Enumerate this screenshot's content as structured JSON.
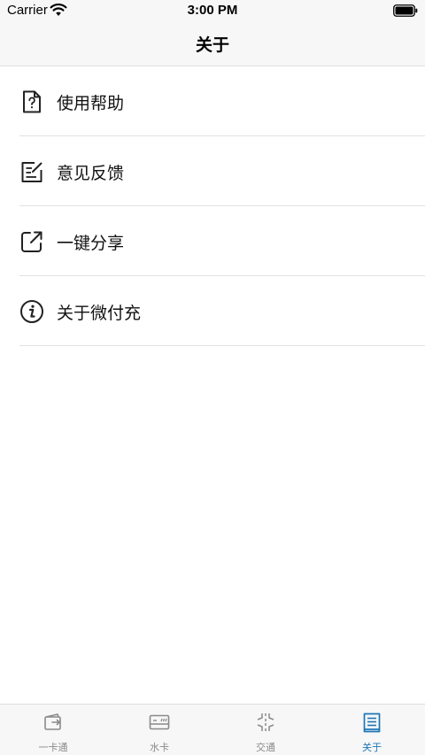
{
  "status_bar": {
    "carrier": "Carrier",
    "time": "3:00 PM",
    "icons": [
      "wifi-icon",
      "battery-icon"
    ]
  },
  "nav": {
    "title": "关于"
  },
  "menu": {
    "items": [
      {
        "label": "使用帮助",
        "icon": "help-document-icon"
      },
      {
        "label": "意见反馈",
        "icon": "feedback-edit-icon"
      },
      {
        "label": "一键分享",
        "icon": "share-external-icon"
      },
      {
        "label": "关于微付充",
        "icon": "info-circle-icon"
      }
    ]
  },
  "tab_bar": {
    "active_color": "#1c76b5",
    "inactive_color": "#8a8a8a",
    "tabs": [
      {
        "label": "一卡通",
        "icon": "card-transfer-icon",
        "active": false
      },
      {
        "label": "水卡",
        "icon": "water-card-icon",
        "active": false
      },
      {
        "label": "交通",
        "icon": "road-icon",
        "active": false
      },
      {
        "label": "关于",
        "icon": "book-icon",
        "active": true
      }
    ]
  }
}
